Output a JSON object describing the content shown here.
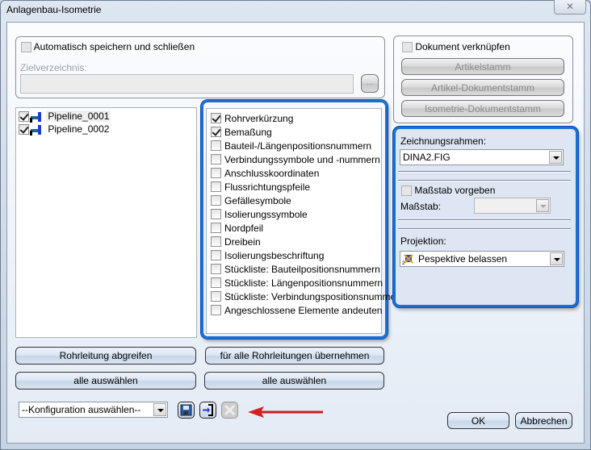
{
  "window": {
    "title": "Anlagenbau-Isometrie",
    "close_icon": "close-icon"
  },
  "autosave": {
    "label": "Automatisch speichern und schließen",
    "checked": false,
    "target_label": "Zielverzeichnis:",
    "target_value": "",
    "browse_label": "..."
  },
  "pipelines": [
    {
      "label": "Pipeline_0001",
      "checked": true
    },
    {
      "label": "Pipeline_0002",
      "checked": true
    }
  ],
  "options": [
    {
      "label": "Rohrverkürzung",
      "checked": true
    },
    {
      "label": "Bemaßung",
      "checked": true
    },
    {
      "label": "Bauteil-/Längenpositionsnummern",
      "checked": false
    },
    {
      "label": "Verbindungssymbole und -nummern",
      "checked": false
    },
    {
      "label": "Anschlusskoordinaten",
      "checked": false
    },
    {
      "label": "Flussrichtungspfeile",
      "checked": false
    },
    {
      "label": "Gefällesymbole",
      "checked": false
    },
    {
      "label": "Isolierungssymbole",
      "checked": false
    },
    {
      "label": "Nordpfeil",
      "checked": false
    },
    {
      "label": "Dreibein",
      "checked": false
    },
    {
      "label": "Isolierungsbeschriftung",
      "checked": false
    },
    {
      "label": "Stückliste: Bauteilpositionsnummern",
      "checked": false
    },
    {
      "label": "Stückliste: Längenpositionsnummern",
      "checked": false
    },
    {
      "label": "Stückliste: Verbindungspositionsnummern",
      "checked": false
    },
    {
      "label": "Angeschlossene Elemente andeuten",
      "checked": false
    }
  ],
  "document": {
    "link_label": "Dokument verknüpfen",
    "buttons": [
      "Artikelstamm",
      "Artikel-Dokumentstamm",
      "Isometrie-Dokumentstamm"
    ]
  },
  "drawing": {
    "frame_label": "Zeichnungsrahmen:",
    "frame_value": "DINA2.FIG",
    "scale_check_label": "Maßstab vorgeben",
    "scale_label": "Maßstab:",
    "scale_value": "",
    "projection_label": "Projektion:",
    "projection_value": "Pespektive belassen"
  },
  "buttons": {
    "pick_pipeline": "Rohrleitung abgreifen",
    "apply_all": "für alle Rohrleitungen übernehmen",
    "select_all_left": "alle auswählen",
    "select_all_right": "alle auswählen",
    "ok": "OK",
    "cancel": "Abbrechen"
  },
  "config": {
    "value": "--Konfiguration auswählen--"
  },
  "colors": {
    "highlight": "#1a6fd6",
    "arrow": "#d42020"
  }
}
